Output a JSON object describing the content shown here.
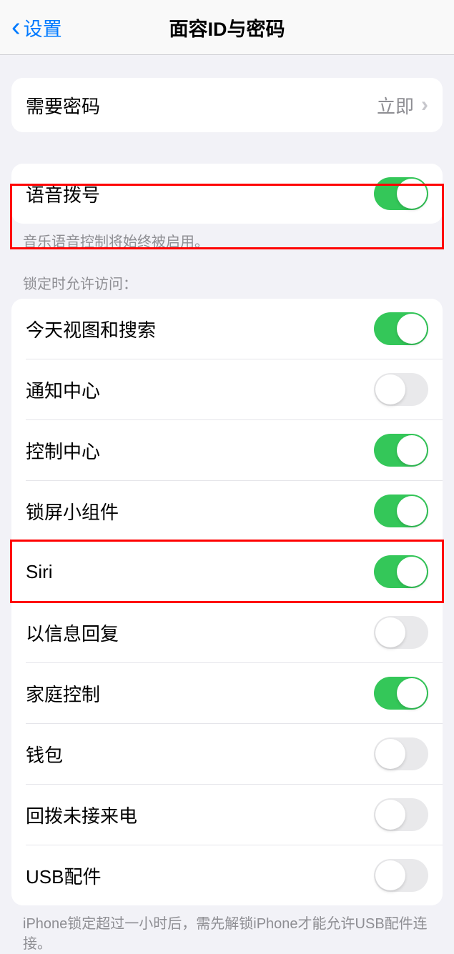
{
  "header": {
    "back_label": "设置",
    "title": "面容ID与密码"
  },
  "require_passcode": {
    "label": "需要密码",
    "value": "立即"
  },
  "voice_dial": {
    "label": "语音拨号",
    "footer": "音乐语音控制将始终被启用。"
  },
  "lock_access": {
    "header": "锁定时允许访问：",
    "items": [
      {
        "label": "今天视图和搜索",
        "on": true
      },
      {
        "label": "通知中心",
        "on": false
      },
      {
        "label": "控制中心",
        "on": true
      },
      {
        "label": "锁屏小组件",
        "on": true
      },
      {
        "label": "Siri",
        "on": true
      },
      {
        "label": "以信息回复",
        "on": false
      },
      {
        "label": "家庭控制",
        "on": true
      },
      {
        "label": "钱包",
        "on": false
      },
      {
        "label": "回拨未接来电",
        "on": false
      },
      {
        "label": "USB配件",
        "on": false
      }
    ],
    "footer": "iPhone锁定超过一小时后，需先解锁iPhone才能允许USB配件连接。"
  }
}
